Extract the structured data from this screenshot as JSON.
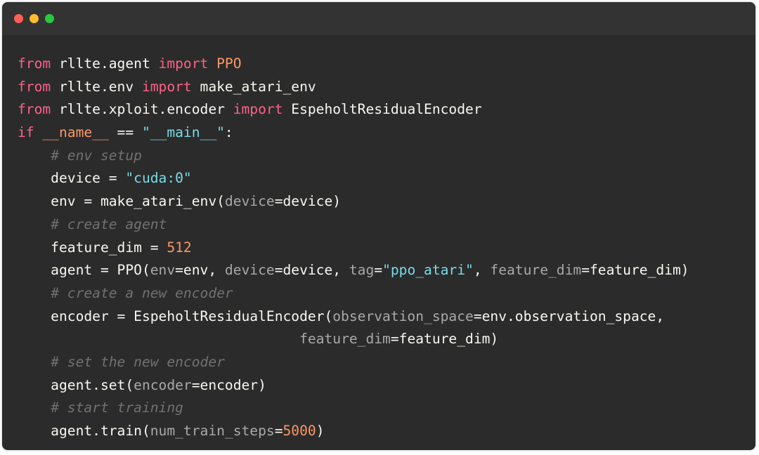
{
  "window": {
    "controls": [
      "close",
      "minimize",
      "maximize"
    ],
    "colors": {
      "close": "#ff5f56",
      "minimize": "#ffbd2e",
      "maximize": "#27c93f"
    }
  },
  "code": {
    "language": "python",
    "lines": [
      [
        {
          "t": "kw",
          "v": "from"
        },
        {
          "t": "txt",
          "v": " rllte.agent "
        },
        {
          "t": "kw",
          "v": "import"
        },
        {
          "t": "txt",
          "v": " "
        },
        {
          "t": "cls",
          "v": "PPO"
        }
      ],
      [
        {
          "t": "kw",
          "v": "from"
        },
        {
          "t": "txt",
          "v": " rllte.env "
        },
        {
          "t": "kw",
          "v": "import"
        },
        {
          "t": "txt",
          "v": " make_atari_env"
        }
      ],
      [
        {
          "t": "kw",
          "v": "from"
        },
        {
          "t": "txt",
          "v": " rllte.xploit.encoder "
        },
        {
          "t": "kw",
          "v": "import"
        },
        {
          "t": "txt",
          "v": " EspeholtResidualEncoder"
        }
      ],
      [
        {
          "t": "kw",
          "v": "if"
        },
        {
          "t": "txt",
          "v": " "
        },
        {
          "t": "dunder",
          "v": "__name__"
        },
        {
          "t": "txt",
          "v": " == "
        },
        {
          "t": "str",
          "v": "\"__main__\""
        },
        {
          "t": "txt",
          "v": ":"
        }
      ],
      [
        {
          "t": "txt",
          "v": "    "
        },
        {
          "t": "cm",
          "v": "# env setup"
        }
      ],
      [
        {
          "t": "txt",
          "v": "    device = "
        },
        {
          "t": "str",
          "v": "\"cuda:0\""
        }
      ],
      [
        {
          "t": "txt",
          "v": "    env = make_atari_env("
        },
        {
          "t": "param",
          "v": "device"
        },
        {
          "t": "txt",
          "v": "=device)"
        }
      ],
      [
        {
          "t": "txt",
          "v": "    "
        },
        {
          "t": "cm",
          "v": "# create agent"
        }
      ],
      [
        {
          "t": "txt",
          "v": "    feature_dim = "
        },
        {
          "t": "num",
          "v": "512"
        }
      ],
      [
        {
          "t": "txt",
          "v": "    agent = PPO("
        },
        {
          "t": "param",
          "v": "env"
        },
        {
          "t": "txt",
          "v": "=env, "
        },
        {
          "t": "param",
          "v": "device"
        },
        {
          "t": "txt",
          "v": "=device, "
        },
        {
          "t": "param",
          "v": "tag"
        },
        {
          "t": "txt",
          "v": "="
        },
        {
          "t": "str",
          "v": "\"ppo_atari\""
        },
        {
          "t": "txt",
          "v": ", "
        },
        {
          "t": "param",
          "v": "feature_dim"
        },
        {
          "t": "txt",
          "v": "=feature_dim)"
        }
      ],
      [
        {
          "t": "txt",
          "v": "    "
        },
        {
          "t": "cm",
          "v": "# create a new encoder"
        }
      ],
      [
        {
          "t": "txt",
          "v": "    encoder = EspeholtResidualEncoder("
        },
        {
          "t": "param",
          "v": "observation_space"
        },
        {
          "t": "txt",
          "v": "=env.observation_space,"
        }
      ],
      [
        {
          "t": "txt",
          "v": "                                  "
        },
        {
          "t": "param",
          "v": "feature_dim"
        },
        {
          "t": "txt",
          "v": "=feature_dim)"
        }
      ],
      [
        {
          "t": "txt",
          "v": "    "
        },
        {
          "t": "cm",
          "v": "# set the new encoder"
        }
      ],
      [
        {
          "t": "txt",
          "v": "    agent.set("
        },
        {
          "t": "param",
          "v": "encoder"
        },
        {
          "t": "txt",
          "v": "=encoder)"
        }
      ],
      [
        {
          "t": "txt",
          "v": "    "
        },
        {
          "t": "cm",
          "v": "# start training"
        }
      ],
      [
        {
          "t": "txt",
          "v": "    agent.train("
        },
        {
          "t": "param",
          "v": "num_train_steps"
        },
        {
          "t": "txt",
          "v": "="
        },
        {
          "t": "num",
          "v": "5000"
        },
        {
          "t": "txt",
          "v": ")"
        }
      ]
    ]
  }
}
